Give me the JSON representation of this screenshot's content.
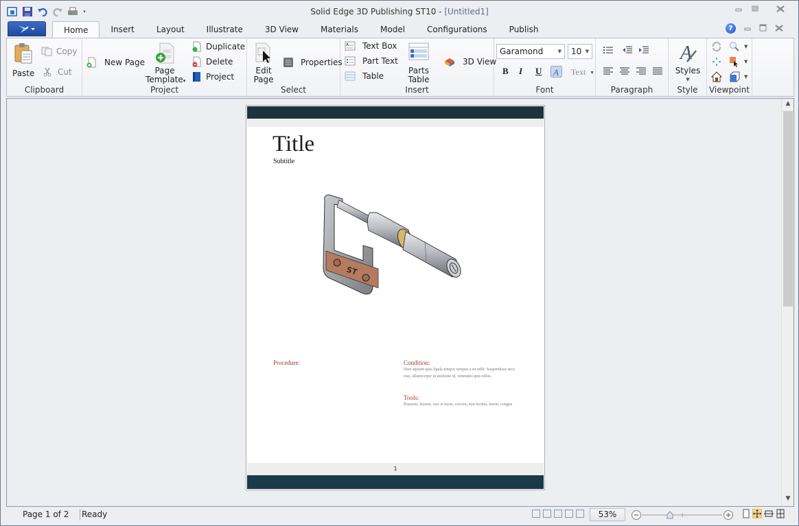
{
  "window": {
    "app_title": "Solid Edge 3D Publishing  ST10 - ",
    "document_name": "[Untitled1]"
  },
  "quick_access": [
    "app-icon",
    "save-icon",
    "undo-icon",
    "redo-icon",
    "print-icon",
    "customize-dropdown-icon"
  ],
  "tabs": [
    {
      "label": "Home",
      "active": true
    },
    {
      "label": "Insert"
    },
    {
      "label": "Layout"
    },
    {
      "label": "Illustrate"
    },
    {
      "label": "3D View"
    },
    {
      "label": "Materials"
    },
    {
      "label": "Model"
    },
    {
      "label": "Configurations"
    },
    {
      "label": "Publish"
    }
  ],
  "ribbon": {
    "clipboard": {
      "label": "Clipboard",
      "paste": "Paste",
      "copy": "Copy",
      "cut": "Cut"
    },
    "project": {
      "label": "Project",
      "new_page": "New Page",
      "page_template_line1": "Page",
      "page_template_line2": "Template",
      "duplicate": "Duplicate",
      "delete": "Delete",
      "project": "Project"
    },
    "select": {
      "label": "Select",
      "edit_page_line1": "Edit",
      "edit_page_line2": "Page",
      "properties": "Properties"
    },
    "insert": {
      "label": "Insert",
      "text_box": "Text Box",
      "part_text": "Part Text",
      "table": "Table",
      "parts_table": "Parts Table",
      "view_3d": "3D View"
    },
    "font": {
      "label": "Font",
      "font_name": "Garamond",
      "font_size": "10",
      "bold": "B",
      "italic": "I",
      "underline": "U",
      "text_effects": "Text"
    },
    "paragraph": {
      "label": "Paragraph"
    },
    "style": {
      "label": "Style",
      "styles": "Styles"
    },
    "viewpoint": {
      "label": "Viewpoint"
    }
  },
  "document": {
    "title": "Title",
    "subtitle": "Subtitle",
    "procedure_heading": "Procedure:",
    "condition_heading": "Condition:",
    "condition_text": "Duis aipsum quis ligula tempor tempus a eu nibh. Suspendisse arcu erat, ullamcorper in molestie id, venenatis quis tellus.",
    "tools_heading": "Tools:",
    "tools_text": "Praesent, laoreet, orci et lacus, viverra, non lacinia, lorem, congue",
    "page_number": "1"
  },
  "status": {
    "page": "Page 1 of 2",
    "state": "Ready",
    "zoom": "53%",
    "zoom_level_fraction": 0.35
  },
  "colors": {
    "header_band": "#1e333d",
    "footer_band": "#1b3a49",
    "heading_red": "#a2362b",
    "app_button": "#2a5bb8"
  }
}
